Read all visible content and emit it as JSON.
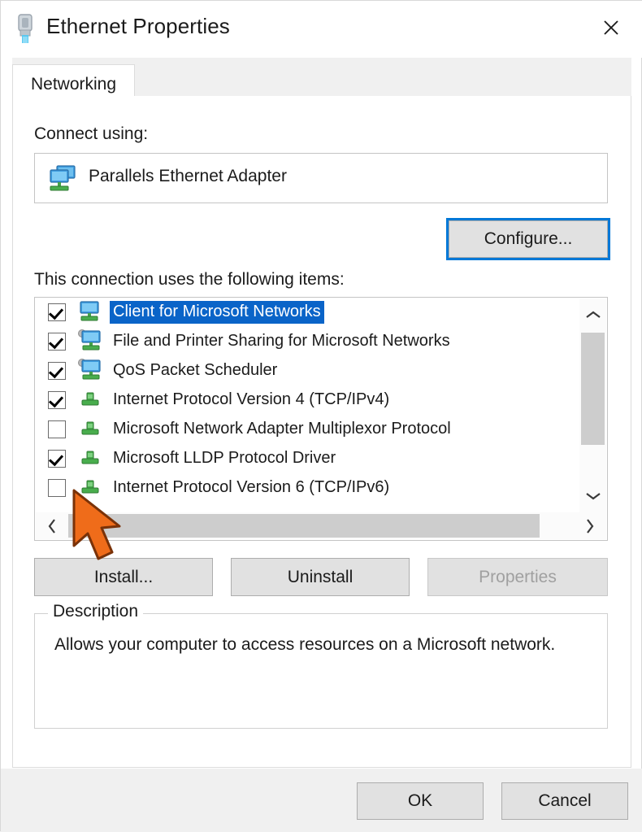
{
  "window": {
    "title": "Ethernet Properties",
    "title_icon": "ethernet-connector-icon",
    "close_label": "✕"
  },
  "tabs": [
    {
      "label": "Networking",
      "active": true
    }
  ],
  "connect_using": {
    "label": "Connect using:",
    "adapter_name": "Parallels Ethernet Adapter",
    "adapter_icon": "network-adapter-icon",
    "configure_label": "Configure...",
    "configure_focused": true
  },
  "items_section": {
    "label": "This connection uses the following items:",
    "items": [
      {
        "label": "Client for Microsoft Networks",
        "checked": true,
        "selected": true,
        "icon": "network-client-icon"
      },
      {
        "label": "File and Printer Sharing for Microsoft Networks",
        "checked": true,
        "selected": false,
        "icon": "network-service-icon"
      },
      {
        "label": "QoS Packet Scheduler",
        "checked": true,
        "selected": false,
        "icon": "network-service-icon"
      },
      {
        "label": "Internet Protocol Version 4 (TCP/IPv4)",
        "checked": true,
        "selected": false,
        "icon": "network-protocol-icon"
      },
      {
        "label": "Microsoft Network Adapter Multiplexor Protocol",
        "checked": false,
        "selected": false,
        "icon": "network-protocol-icon"
      },
      {
        "label": "Microsoft LLDP Protocol Driver",
        "checked": true,
        "selected": false,
        "icon": "network-protocol-icon"
      },
      {
        "label": "Internet Protocol Version 6 (TCP/IPv6)",
        "checked": false,
        "selected": false,
        "icon": "network-protocol-icon"
      }
    ],
    "scroll_up_icon": "chevron-up-icon",
    "scroll_down_icon": "chevron-down-icon",
    "scroll_left_icon": "chevron-left-icon",
    "scroll_right_icon": "chevron-right-icon"
  },
  "actions": {
    "install_label": "Install...",
    "uninstall_label": "Uninstall",
    "properties_label": "Properties",
    "properties_disabled": true
  },
  "description": {
    "legend": "Description",
    "text": "Allows your computer to access resources on a Microsoft network."
  },
  "footer": {
    "ok_label": "OK",
    "cancel_label": "Cancel"
  },
  "cursor": {
    "icon": "arrow-cursor-pointer",
    "color": "#ef6c1a"
  },
  "colors": {
    "accent_focus": "#0078d7",
    "selection": "#0a64c8",
    "dialog_bg": "#ffffff",
    "footer_bg": "#f0f0f0",
    "button_face": "#e1e1e1",
    "disabled_text": "#a0a0a0"
  }
}
